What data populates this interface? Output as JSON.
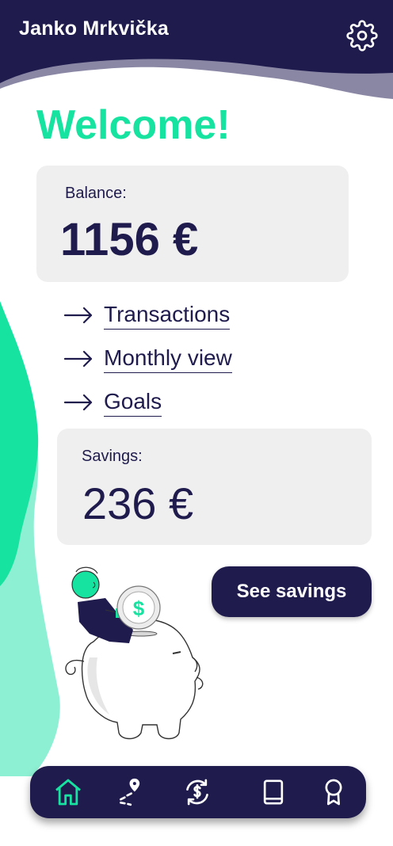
{
  "header": {
    "user_name": "Janko Mrkvička",
    "settings_icon": "gear-icon"
  },
  "main": {
    "welcome": "Welcome!",
    "balance": {
      "label": "Balance:",
      "value": "1156 €"
    },
    "links": [
      {
        "label": "Transactions",
        "icon": "arrow-right-icon"
      },
      {
        "label": "Monthly view",
        "icon": "arrow-right-icon"
      },
      {
        "label": "Goals",
        "icon": "arrow-right-icon"
      }
    ],
    "savings": {
      "label": "Savings:",
      "value": "236 €"
    },
    "see_savings_label": "See savings"
  },
  "bottom_nav": {
    "tabs": [
      {
        "icon": "home-icon",
        "active": true
      },
      {
        "icon": "route-icon",
        "active": false
      },
      {
        "icon": "currency-exchange-icon",
        "active": false
      },
      {
        "icon": "book-icon",
        "active": false
      },
      {
        "icon": "award-icon",
        "active": false
      }
    ]
  },
  "colors": {
    "navy": "#1f1b4d",
    "accent_green": "#16e3a0",
    "light_green": "#8ef0d2",
    "card_gray": "#efefef",
    "wave_gray": "#8a87a5"
  }
}
